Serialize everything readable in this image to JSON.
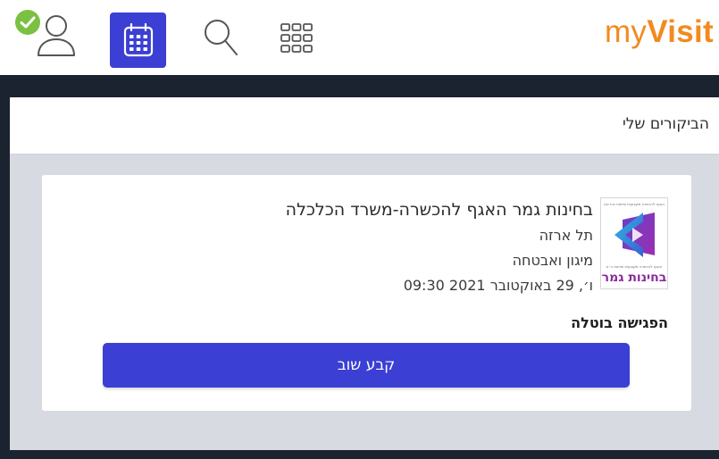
{
  "header": {
    "brand_prefix": "my",
    "brand_bold": "Visit",
    "icons": [
      "profile-icon",
      "check-badge-icon",
      "calendar-icon",
      "search-icon",
      "apps-grid-icon"
    ]
  },
  "section": {
    "title": "הביקורים שלי"
  },
  "visit": {
    "title": "בחינות גמר האגף להכשרה-משרד הכלכלה",
    "location": "תל ארזה",
    "service": "מיגון ואבטחה",
    "datetime": "ו׳, 29 באוקטובר 2021 09:30",
    "status": "הפגישה בוטלה",
    "logo_text": "בחינות גמר",
    "logo_header_text": "האגף להכשרה מקצועית ופיתוח כוח אדם",
    "logo_small_text": "האגף להכשרה מקצועית ופיתוח כ״א",
    "rebook_label": "קבע שוב"
  },
  "colors": {
    "accent": "#3b3fd3",
    "brand": "#f28a1f",
    "dark_frame": "#1c2330",
    "content_bg": "#d8dae1",
    "check_green": "#7ac142",
    "logo_purple": "#8a2b9c"
  }
}
